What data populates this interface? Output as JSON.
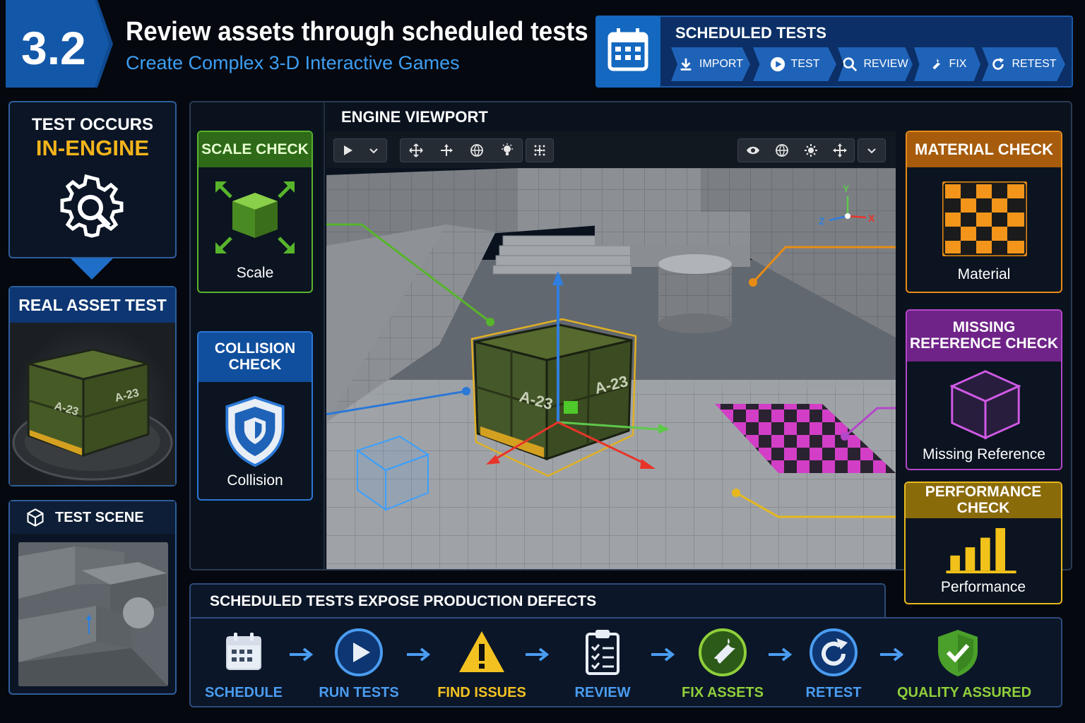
{
  "header": {
    "badge": "3.2",
    "title": "Review assets through scheduled tests",
    "subtitle": "Create Complex 3-D Interactive Games"
  },
  "scheduled_tests": {
    "title": "SCHEDULED TESTS",
    "steps": [
      {
        "label": "IMPORT",
        "icon": "download-icon"
      },
      {
        "label": "TEST",
        "icon": "play-icon"
      },
      {
        "label": "REVIEW",
        "icon": "search-icon"
      },
      {
        "label": "FIX",
        "icon": "wrench-icon"
      },
      {
        "label": "RETEST",
        "icon": "refresh-icon"
      }
    ]
  },
  "left": {
    "engine_line1": "TEST OCCURS",
    "engine_line2": "IN-ENGINE",
    "real_asset": "REAL ASSET TEST",
    "crate_label": "A-23",
    "test_scene": "TEST SCENE"
  },
  "viewport": {
    "title": "ENGINE VIEWPORT",
    "axis_x": "X",
    "axis_y": "Y",
    "axis_z": "Z"
  },
  "checks": {
    "scale": {
      "title": "SCALE CHECK",
      "label": "Scale"
    },
    "collision": {
      "title": "COLLISION CHECK",
      "label": "Collision"
    },
    "material": {
      "title": "MATERIAL CHECK",
      "label": "Material"
    },
    "missing": {
      "title": "MISSING REFERENCE CHECK",
      "label": "Missing Reference"
    },
    "performance": {
      "title": "PERFORMANCE CHECK",
      "label": "Performance"
    }
  },
  "process": {
    "title": "SCHEDULED TESTS EXPOSE PRODUCTION DEFECTS",
    "steps": [
      {
        "label": "SCHEDULE",
        "color": "#4a9cf0"
      },
      {
        "label": "RUN TESTS",
        "color": "#4a9cf0"
      },
      {
        "label": "FIND ISSUES",
        "color": "#f3c221"
      },
      {
        "label": "REVIEW",
        "color": "#4a9cf0"
      },
      {
        "label": "FIX ASSETS",
        "color": "#8fcf3a"
      },
      {
        "label": "RETEST",
        "color": "#4a9cf0"
      },
      {
        "label": "QUALITY ASSURED",
        "color": "#8fcf3a"
      }
    ]
  },
  "colors": {
    "accent_blue": "#1f63b8",
    "scale_green": "#57b42b",
    "collision_blue": "#2c78d6",
    "material_orange": "#e88b14",
    "missing_purple": "#b447c8",
    "performance_yellow": "#e7b81e"
  }
}
